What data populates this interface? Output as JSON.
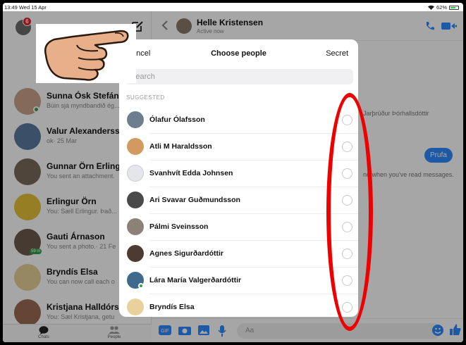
{
  "status_bar": {
    "time_date": "13:49 Wed 15 Apr",
    "battery": "62%"
  },
  "colors": {
    "accent": "#2e89ff",
    "online": "#31a24c",
    "badge": "#e4212b",
    "annotation": "#ee0000"
  },
  "sidebar": {
    "badge_count": "6",
    "conversations": [
      {
        "name": "Sunna Ósk Stefánsd",
        "preview": "Búin sjá myndbandið ég...",
        "online": true
      },
      {
        "name": "Valur Alexandersson",
        "preview": "ok· 25 Mar",
        "online": false
      },
      {
        "name": "Gunnar Örn Erlingss",
        "preview": "You sent an attachment.",
        "online": false
      },
      {
        "name": "Erlingur Örn",
        "preview": "You: Sæll Erlingur. Það...",
        "online": false
      },
      {
        "name": "Gauti Árnason",
        "preview": "You sent a photo.· 21 Fe",
        "online": false,
        "badge": "59 m"
      },
      {
        "name": "Bryndís Elsa",
        "preview": "You can now call each o",
        "online": false
      },
      {
        "name": "Kristjana Halldórsdó",
        "preview": "You: Sæl Kristjana, getu",
        "online": false
      }
    ],
    "tabs": [
      {
        "label": "Chats",
        "icon": "chat-bubble-icon"
      },
      {
        "label": "People",
        "icon": "people-icon"
      }
    ]
  },
  "conversation": {
    "contact_name": "Helle Kristensen",
    "contact_status": "Active now",
    "thread_fragment_1": "Jarþrúður Þórhallsdóttir",
    "thread_fragment_2": "nd when you've read messages.",
    "sent_bubble": "Prufa",
    "composer_placeholder": "Aa"
  },
  "modal": {
    "cancel_label": "ancel",
    "title": "Choose people",
    "secret_label": "Secret",
    "search_placeholder": "Search",
    "section_label": "SUGGESTED",
    "people": [
      {
        "name": "Ólafur Ólafsson",
        "online": false
      },
      {
        "name": "Atli M Haraldsson",
        "online": false
      },
      {
        "name": "Svanhvít Edda Johnsen",
        "online": false
      },
      {
        "name": "Ari Svavar Guðmundsson",
        "online": false
      },
      {
        "name": "Pálmi Sveinsson",
        "online": false
      },
      {
        "name": "Agnes Sigurðardóttir",
        "online": false
      },
      {
        "name": "Lára María Valgerðardóttir",
        "online": true
      },
      {
        "name": "Bryndís Elsa",
        "online": false
      }
    ]
  }
}
